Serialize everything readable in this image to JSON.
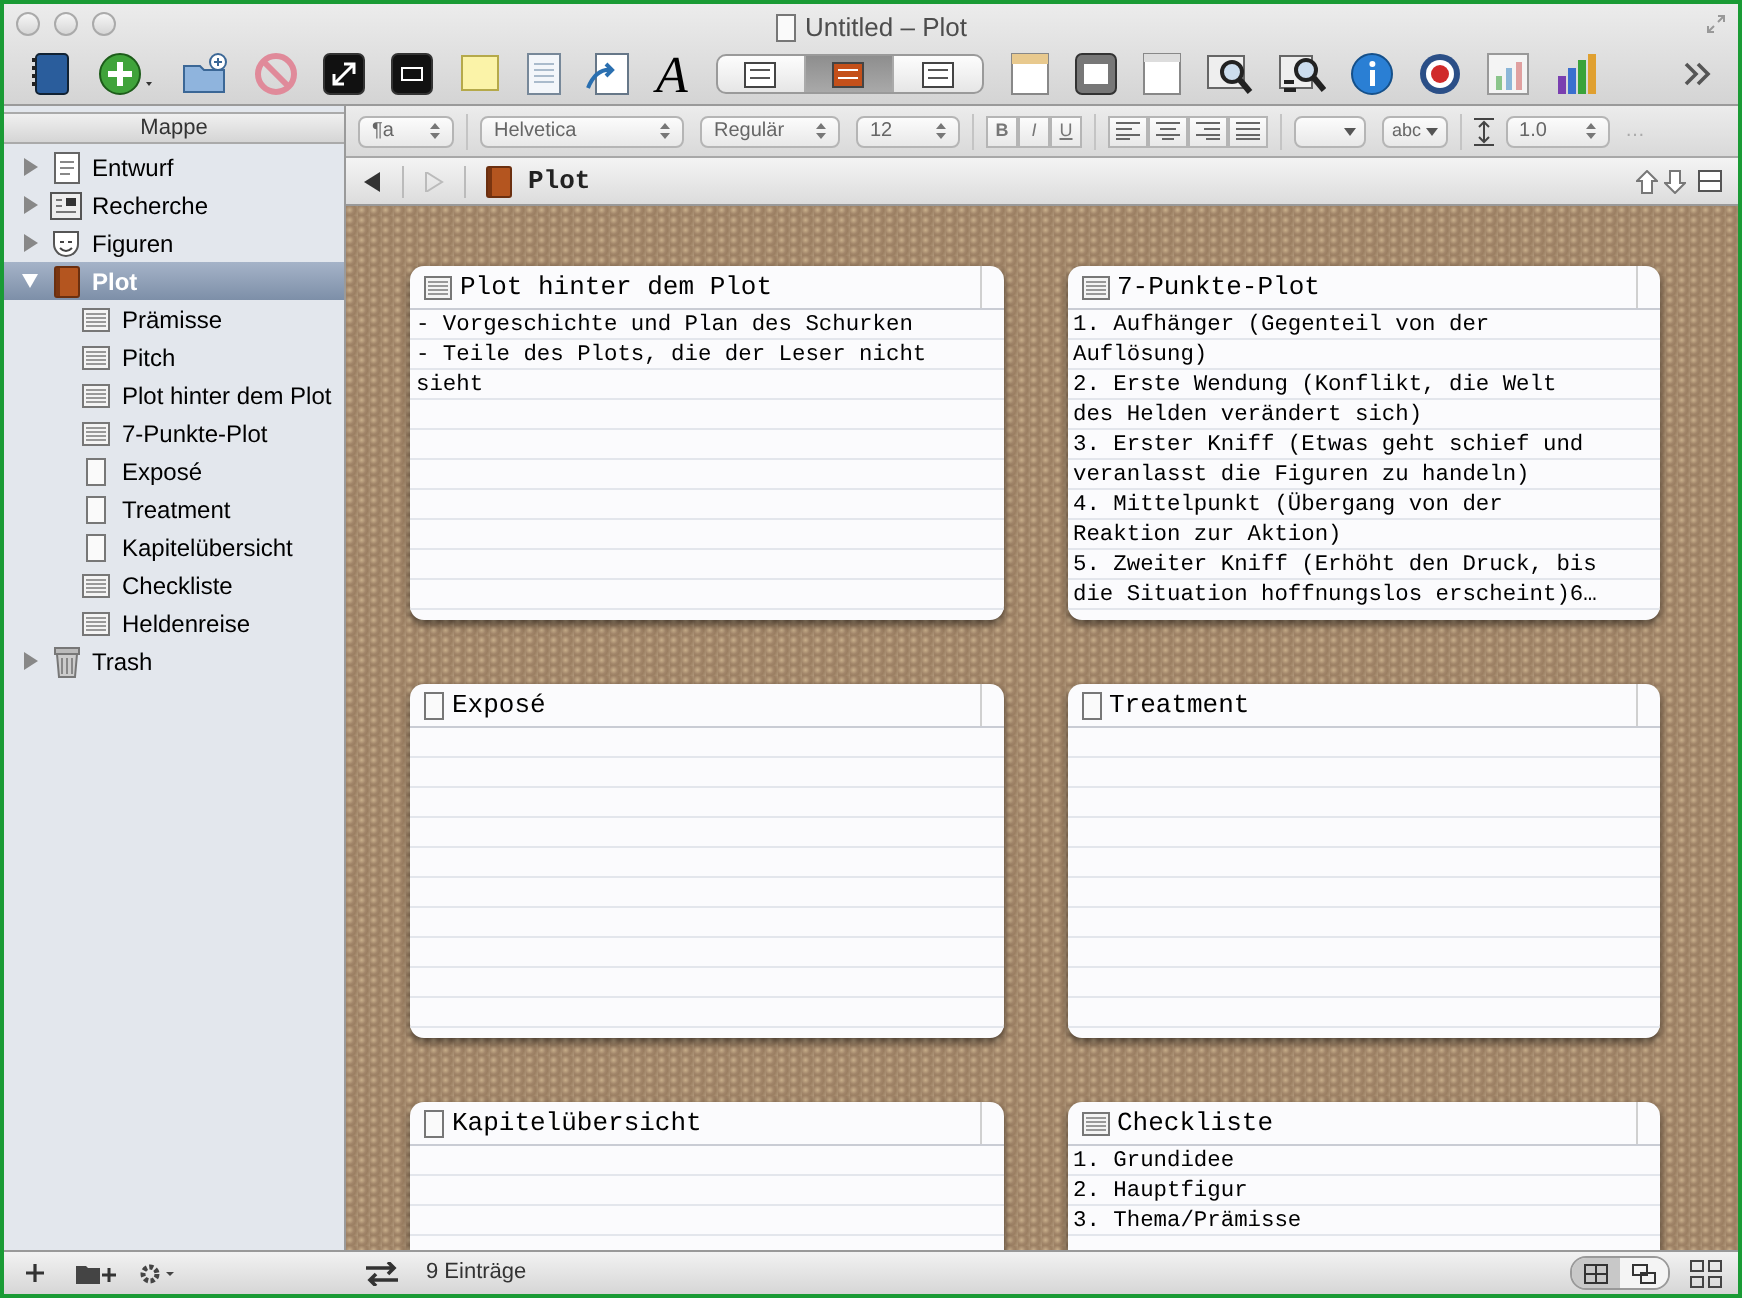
{
  "window": {
    "title": "Untitled – Plot"
  },
  "toolbar": {
    "font_button": "A",
    "view_modes": [
      {
        "selected": false
      },
      {
        "selected": true
      },
      {
        "selected": false
      }
    ]
  },
  "binder": {
    "header": "Mappe",
    "items": [
      {
        "label": "Entwurf",
        "kind": "draft",
        "expanded": false,
        "selected": false
      },
      {
        "label": "Recherche",
        "kind": "research",
        "expanded": false,
        "selected": false
      },
      {
        "label": "Figuren",
        "kind": "characters",
        "expanded": false,
        "selected": false
      },
      {
        "label": "Plot",
        "kind": "book",
        "expanded": true,
        "selected": true,
        "children": [
          {
            "label": "Prämisse",
            "kind": "text",
            "selected": false
          },
          {
            "label": "Pitch",
            "kind": "text",
            "selected": false
          },
          {
            "label": "Plot hinter dem Plot",
            "kind": "text",
            "selected": false
          },
          {
            "label": "7-Punkte-Plot",
            "kind": "text",
            "selected": false
          },
          {
            "label": "Exposé",
            "kind": "page",
            "selected": false
          },
          {
            "label": "Treatment",
            "kind": "page",
            "selected": false
          },
          {
            "label": "Kapitelübersicht",
            "kind": "page",
            "selected": false
          },
          {
            "label": "Checkliste",
            "kind": "text",
            "selected": false
          },
          {
            "label": "Heldenreise",
            "kind": "text",
            "selected": false
          }
        ]
      },
      {
        "label": "Trash",
        "kind": "trash",
        "expanded": false,
        "selected": false
      }
    ]
  },
  "format_bar": {
    "paragraph_style": "¶a",
    "font": "Helvetica",
    "style": "Regulär",
    "size": "12",
    "bold": "B",
    "italic": "I",
    "underline": "U",
    "highlight": "abc",
    "line_spacing": "1.0",
    "more": "…"
  },
  "header_bar": {
    "title": "Plot",
    "back_disabled": false,
    "forward_disabled": true
  },
  "corkboard": {
    "cards": [
      {
        "title": "Plot hinter dem Plot",
        "kind": "text",
        "lines": [
          "- Vorgeschichte und Plan des Schurken",
          "- Teile des Plots, die der Leser nicht",
          "sieht"
        ]
      },
      {
        "title": "7-Punkte-Plot",
        "kind": "text",
        "lines": [
          "1. Aufhänger (Gegenteil von der",
          "Auflösung)",
          "2. Erste Wendung (Konflikt, die Welt",
          "des Helden verändert sich)",
          "3. Erster Kniff (Etwas geht schief und",
          "veranlasst die Figuren zu handeln)",
          "4. Mittelpunkt (Übergang von der",
          "Reaktion zur Aktion)",
          "5. Zweiter Kniff (Erhöht den Druck, bis",
          "die Situation hoffnungslos erscheint)6…"
        ]
      },
      {
        "title": "Exposé",
        "kind": "page"
      },
      {
        "title": "Treatment",
        "kind": "page"
      },
      {
        "title": "Kapitelübersicht",
        "kind": "page"
      },
      {
        "title": "Checkliste",
        "kind": "text",
        "lines": [
          "1. Grundidee",
          "2. Hauptfigur",
          "3. Thema/Prämisse"
        ]
      }
    ]
  },
  "footer": {
    "count": "9 Einträge",
    "view_toggle": [
      {
        "selected": true
      },
      {
        "selected": false
      }
    ]
  }
}
